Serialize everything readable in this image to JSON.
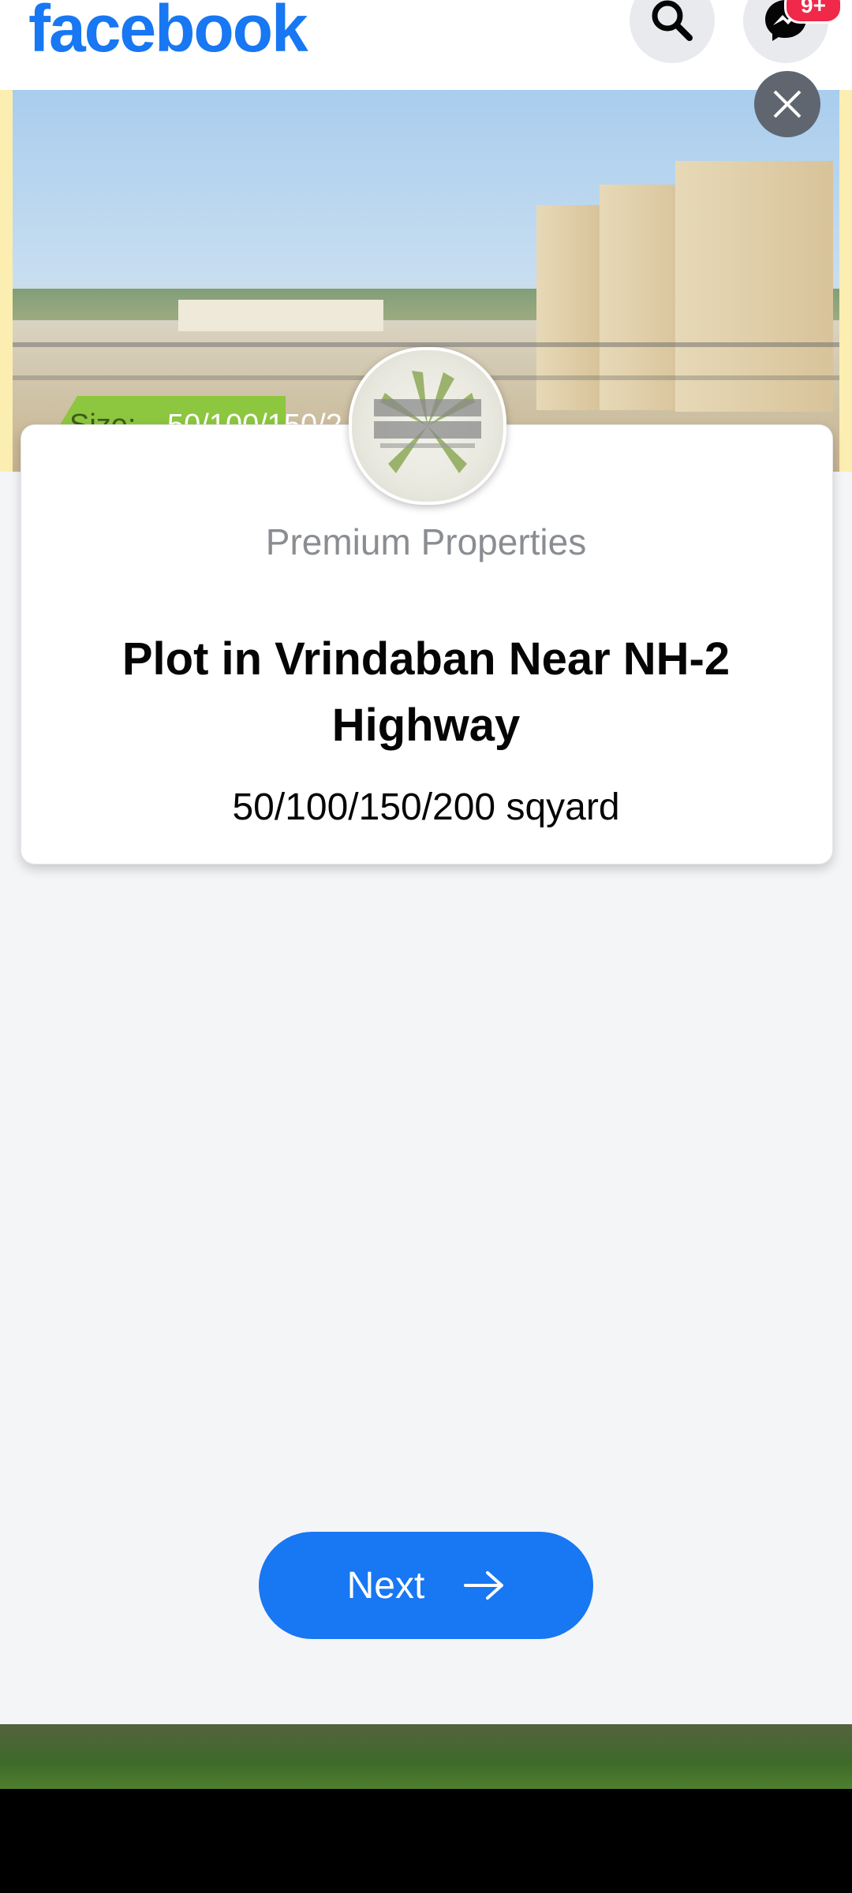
{
  "app": {
    "brand": "facebook"
  },
  "header": {
    "search_icon": "search-icon",
    "messenger_icon": "messenger-icon",
    "messenger_badge": "9+"
  },
  "hero": {
    "size_label": "Size:",
    "size_value": "50/100/150/2"
  },
  "card": {
    "advertiser_name": "Premium Properties",
    "title": "Plot in Vrindaban Near NH-2 Highway",
    "subtitle": "50/100/150/200 sqyard"
  },
  "actions": {
    "next_label": "Next"
  },
  "colors": {
    "brand_blue": "#1877f2",
    "badge_red": "#f02849",
    "close_button": "#5f6670",
    "size_tag_green": "#8dc63f"
  }
}
